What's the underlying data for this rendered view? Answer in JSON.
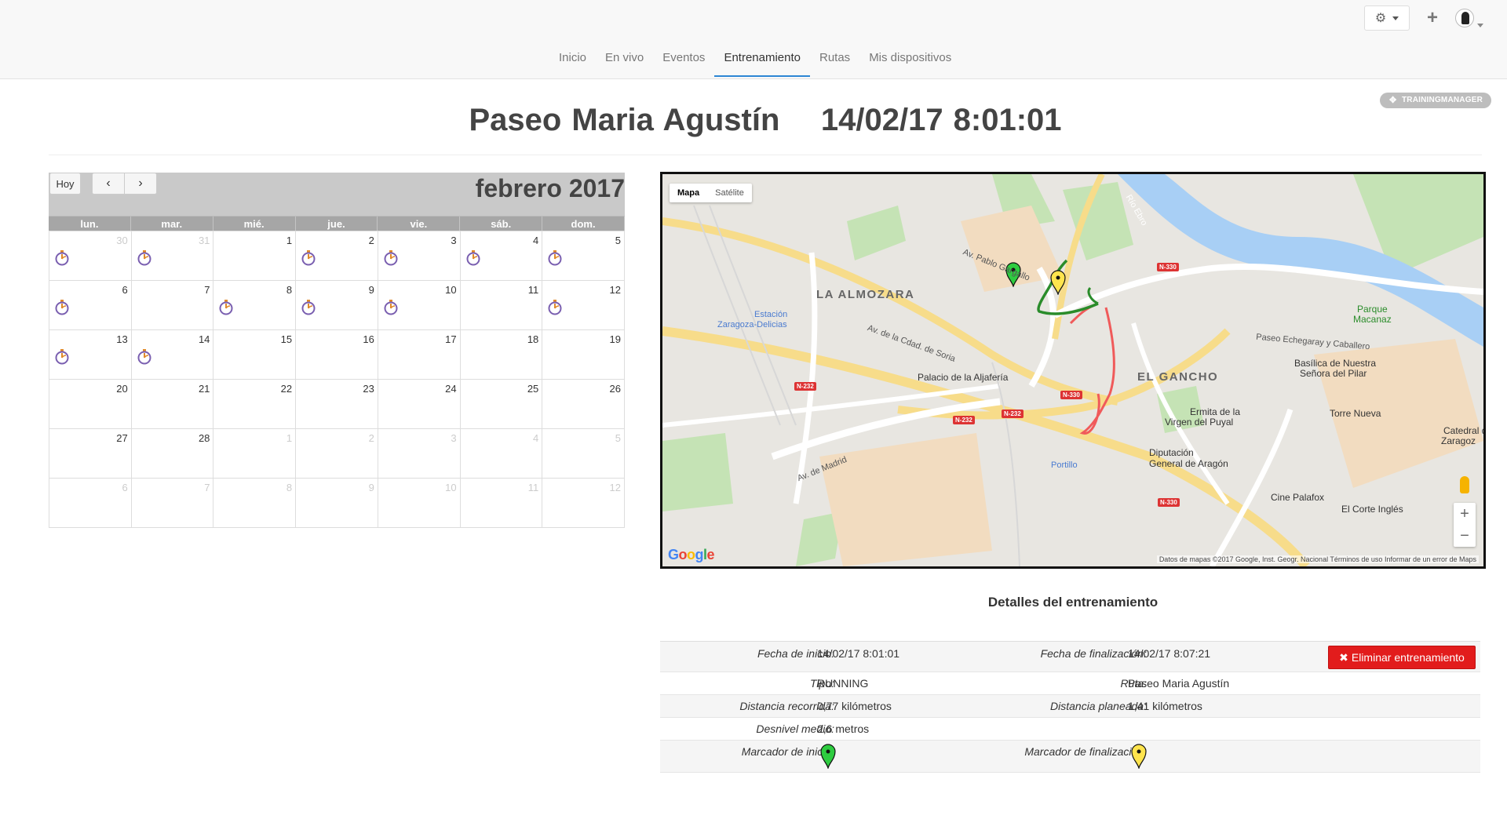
{
  "topbar": {
    "nav": [
      "Inicio",
      "En vivo",
      "Eventos",
      "Entrenamiento",
      "Rutas",
      "Mis dispositivos"
    ],
    "active_nav": "Entrenamiento",
    "badge": "TRAININGMANAGER"
  },
  "title": {
    "name": "Paseo Maria Agustín",
    "datetime": "14/02/17 8:01:01"
  },
  "calendar": {
    "today_label": "Hoy",
    "month_label": "febrero 2017",
    "weekdays": [
      "lun.",
      "mar.",
      "mié.",
      "jue.",
      "vie.",
      "sáb.",
      "dom."
    ],
    "weeks": [
      [
        {
          "d": "30",
          "o": true,
          "e": true
        },
        {
          "d": "31",
          "o": true,
          "e": true
        },
        {
          "d": "1",
          "o": false,
          "e": false
        },
        {
          "d": "2",
          "o": false,
          "e": true
        },
        {
          "d": "3",
          "o": false,
          "e": true
        },
        {
          "d": "4",
          "o": false,
          "e": true
        },
        {
          "d": "5",
          "o": false,
          "e": true
        }
      ],
      [
        {
          "d": "6",
          "o": false,
          "e": true
        },
        {
          "d": "7",
          "o": false,
          "e": false
        },
        {
          "d": "8",
          "o": false,
          "e": true
        },
        {
          "d": "9",
          "o": false,
          "e": true
        },
        {
          "d": "10",
          "o": false,
          "e": true
        },
        {
          "d": "11",
          "o": false,
          "e": false
        },
        {
          "d": "12",
          "o": false,
          "e": true
        }
      ],
      [
        {
          "d": "13",
          "o": false,
          "e": true
        },
        {
          "d": "14",
          "o": false,
          "e": true
        },
        {
          "d": "15",
          "o": false,
          "e": false
        },
        {
          "d": "16",
          "o": false,
          "e": false
        },
        {
          "d": "17",
          "o": false,
          "e": false
        },
        {
          "d": "18",
          "o": false,
          "e": false
        },
        {
          "d": "19",
          "o": false,
          "e": false
        }
      ],
      [
        {
          "d": "20",
          "o": false,
          "e": false
        },
        {
          "d": "21",
          "o": false,
          "e": false
        },
        {
          "d": "22",
          "o": false,
          "e": false
        },
        {
          "d": "23",
          "o": false,
          "e": false
        },
        {
          "d": "24",
          "o": false,
          "e": false
        },
        {
          "d": "25",
          "o": false,
          "e": false
        },
        {
          "d": "26",
          "o": false,
          "e": false
        }
      ],
      [
        {
          "d": "27",
          "o": false,
          "e": false
        },
        {
          "d": "28",
          "o": false,
          "e": false
        },
        {
          "d": "1",
          "o": true,
          "e": false
        },
        {
          "d": "2",
          "o": true,
          "e": false
        },
        {
          "d": "3",
          "o": true,
          "e": false
        },
        {
          "d": "4",
          "o": true,
          "e": false
        },
        {
          "d": "5",
          "o": true,
          "e": false
        }
      ],
      [
        {
          "d": "6",
          "o": true,
          "e": false
        },
        {
          "d": "7",
          "o": true,
          "e": false
        },
        {
          "d": "8",
          "o": true,
          "e": false
        },
        {
          "d": "9",
          "o": true,
          "e": false
        },
        {
          "d": "10",
          "o": true,
          "e": false
        },
        {
          "d": "11",
          "o": true,
          "e": false
        },
        {
          "d": "12",
          "o": true,
          "e": false
        }
      ]
    ]
  },
  "map": {
    "type_map": "Mapa",
    "type_satellite": "Satélite",
    "labels": {
      "la_almozara": "LA ALMOZARA",
      "el_gancho": "EL GANCHO",
      "estacion": "Estación",
      "zaragoza_delicias": "Zaragoza-Delicias",
      "palacio": "Palacio de la Aljafería",
      "diputacion": "Diputación",
      "general_aragon": "General de Aragón",
      "ermita": "Ermita de la",
      "virgen_puyal": "Virgen del Puyal",
      "basilica": "Basílica de Nuestra",
      "senora_pilar": "Señora del Pilar",
      "torre_nueva": "Torre Nueva",
      "cine_palafox": "Cine Palafox",
      "corte_ingles": "El Corte Inglés",
      "portillo": "Portillo",
      "parque": "Parque",
      "macanaz": "Macanaz",
      "catedral": "Catedral de",
      "zaragoz": "Zaragoz",
      "av_soria": "Av. de la Cdad. de Soria",
      "av_pablo": "Av. Pablo Gargallo",
      "av_madrid": "Av. de Madrid",
      "paseo_echegaray": "Paseo Echegaray y Caballero",
      "rio_ebro": "Río Ebro",
      "n330": "N-330",
      "n232": "N-232",
      "credit": "Datos de mapas ©2017 Google, Inst. Geogr. Nacional   Términos de uso   Informar de un error de Maps",
      "google": "Google"
    }
  },
  "details": {
    "title": "Detalles del entrenamiento",
    "fecha_inicio_label": "Fecha de inicio:",
    "fecha_inicio": "14/02/17 8:01:01",
    "fecha_fin_label": "Fecha de finalización:",
    "fecha_fin": "14/02/17 8:07:21",
    "delete_label": "Eliminar entrenamiento",
    "tipo_label": "Tipo:",
    "tipo": "RUNNING",
    "ruta_label": "Ruta:",
    "ruta": "Paseo Maria Agustín",
    "dist_rec_label": "Distancia recorrida:",
    "dist_rec": "0,77 kilómetros",
    "dist_plan_label": "Distancia planeada:",
    "dist_plan": "1,41 kilómetros",
    "desnivel_label": "Desnivel medio:",
    "desnivel": "2,6 metros",
    "marcador_inicio_label": "Marcador de inicio:",
    "marcador_fin_label": "Marcador de finalización:",
    "start_color": "#2ecc40",
    "end_color": "#ffe44d"
  }
}
